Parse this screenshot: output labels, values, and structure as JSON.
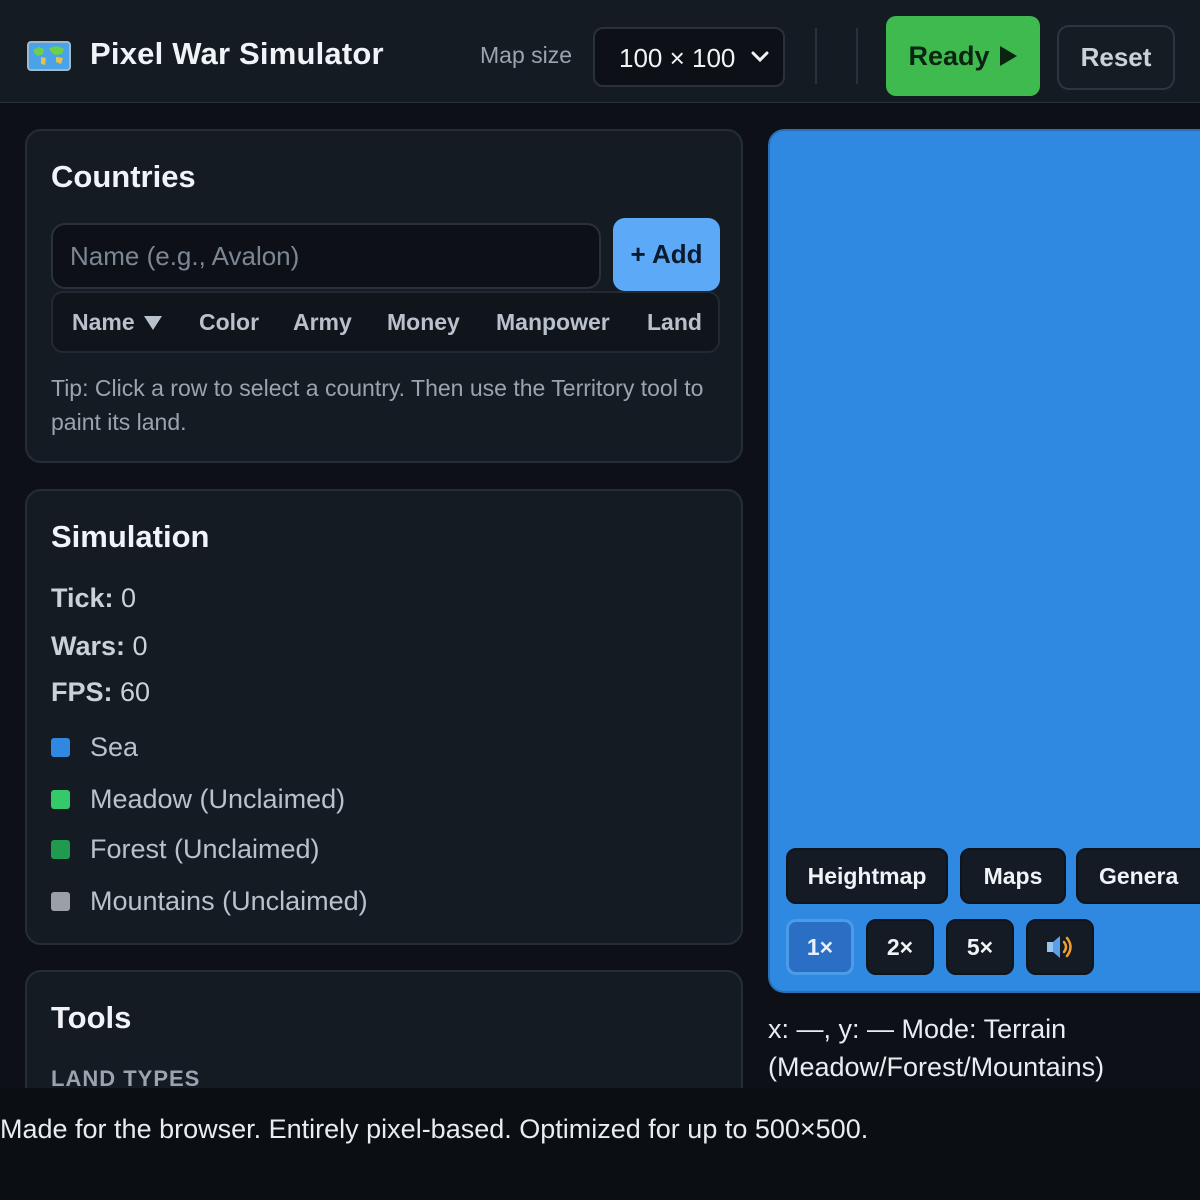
{
  "header": {
    "title": "Pixel War Simulator",
    "map_size_label": "Map size",
    "map_size_value": "100 × 100",
    "ready_label": "Ready",
    "reset_label": "Reset"
  },
  "countries": {
    "title": "Countries",
    "name_placeholder": "Name (e.g., Avalon)",
    "add_label": "+ Add",
    "columns": [
      "Name",
      "Color",
      "Army",
      "Money",
      "Manpower",
      "Land"
    ],
    "sort_column": "Name",
    "sort_direction": "descending",
    "tip": "Tip: Click a row to select a country. Then use the Territory tool to paint its land."
  },
  "simulation": {
    "title": "Simulation",
    "tick_label": "Tick:",
    "tick_value": "0",
    "wars_label": "Wars:",
    "wars_value": "0",
    "fps_label": "FPS:",
    "fps_value": "60",
    "legend": [
      {
        "label": "Sea",
        "color": "#2f89e0"
      },
      {
        "label": "Meadow (Unclaimed)",
        "color": "#34c96a"
      },
      {
        "label": "Forest (Unclaimed)",
        "color": "#1f9a4e"
      },
      {
        "label": "Mountains (Unclaimed)",
        "color": "#9aa0a6"
      }
    ]
  },
  "tools": {
    "title": "Tools",
    "land_types_label": "LAND TYPES"
  },
  "map": {
    "sea_color": "#2f89e0",
    "buttons": [
      "Heightmap",
      "Maps",
      "Genera"
    ],
    "speeds": [
      "1×",
      "2×",
      "5×"
    ],
    "active_speed": "1×",
    "sound_icon": "speaker-icon",
    "coords": "x: —, y: — Mode: Terrain (Meadow/Forest/Mountains)"
  },
  "footer": {
    "text": "Made for the browser. Entirely pixel-based. Optimized for up to 500×500."
  }
}
